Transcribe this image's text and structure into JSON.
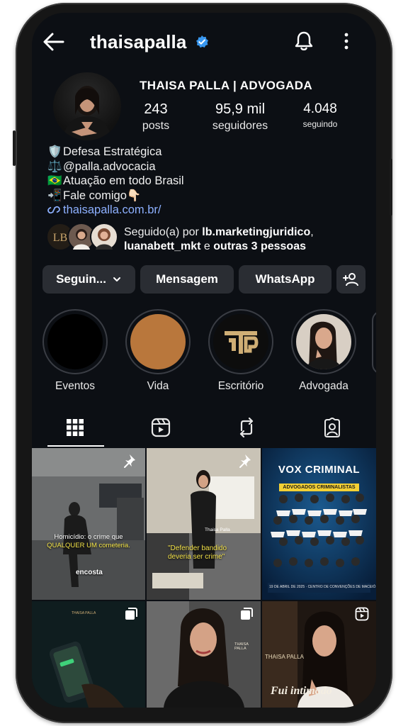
{
  "header": {
    "username": "thaisapalla",
    "back_icon": "arrow-left-icon",
    "verified_icon": "verified-badge-icon",
    "bell_icon": "bell-icon",
    "menu_icon": "more-vertical-icon"
  },
  "profile": {
    "full_name": "THAISA PALLA | ADVOGADA",
    "stats": [
      {
        "num": "243",
        "label": "posts"
      },
      {
        "num": "95,9 mil",
        "label": "seguidores"
      },
      {
        "num": "4.048",
        "label": "seguindo"
      }
    ]
  },
  "bio": {
    "lines": [
      {
        "emoji": "🛡️",
        "text": "Defesa Estratégica"
      },
      {
        "emoji": "⚖️",
        "text": "@palla.advocacia"
      },
      {
        "emoji": "🇧🇷",
        "text": "Atuação em todo Brasil"
      },
      {
        "emoji": "📲",
        "text": "Fale comigo👇🏻"
      }
    ],
    "link_icon": "link-icon",
    "link": "thaisapalla.com.br/"
  },
  "followed_by": {
    "prefix": "Seguido(a) por ",
    "name1": "lb.marketingjuridico",
    "comma": ",",
    "name2": "luanabett_mkt",
    "middle": " e ",
    "others": "outras 3 pessoas"
  },
  "actions": {
    "following": "Seguin...",
    "message": "Mensagem",
    "whatsapp": "WhatsApp",
    "add_user_icon": "add-person-icon"
  },
  "highlights": [
    {
      "label": "Eventos",
      "color": "#000000"
    },
    {
      "label": "Vida",
      "color": "#b9773c"
    },
    {
      "label": "Escritório",
      "color": "#0d0d0d"
    },
    {
      "label": "Advogada",
      "color": "#d8cfc4"
    }
  ],
  "tabs": [
    "grid-icon",
    "reels-icon",
    "repost-icon",
    "tagged-icon"
  ],
  "posts": [
    {
      "caption1": "Homicídio: o crime que",
      "caption2": "QUALQUER UM cometeria.",
      "caption3": "encosta",
      "badge": "pin-icon"
    },
    {
      "caption1": "\"Defender bandido",
      "caption2": "deveria ser crime\"",
      "handle": "Thaisa Palla",
      "badge": "pin-icon"
    },
    {
      "brand": "VOX CRIMINAL",
      "subtitle": "ADVOGADOS CRIMINALISTAS",
      "footer": "19 DE ABRIL DE 2025 · CENTRO DE CONVENÇÕES DE MACEIÓ"
    },
    {
      "badge": "carousel-icon",
      "logo": "THAISA PALLA"
    },
    {
      "badge": "carousel-icon",
      "logo": "THAISA PALLA"
    },
    {
      "badge": "reel-icon",
      "logo": "THAISA PALLA",
      "caption": "Fui intimado"
    }
  ]
}
